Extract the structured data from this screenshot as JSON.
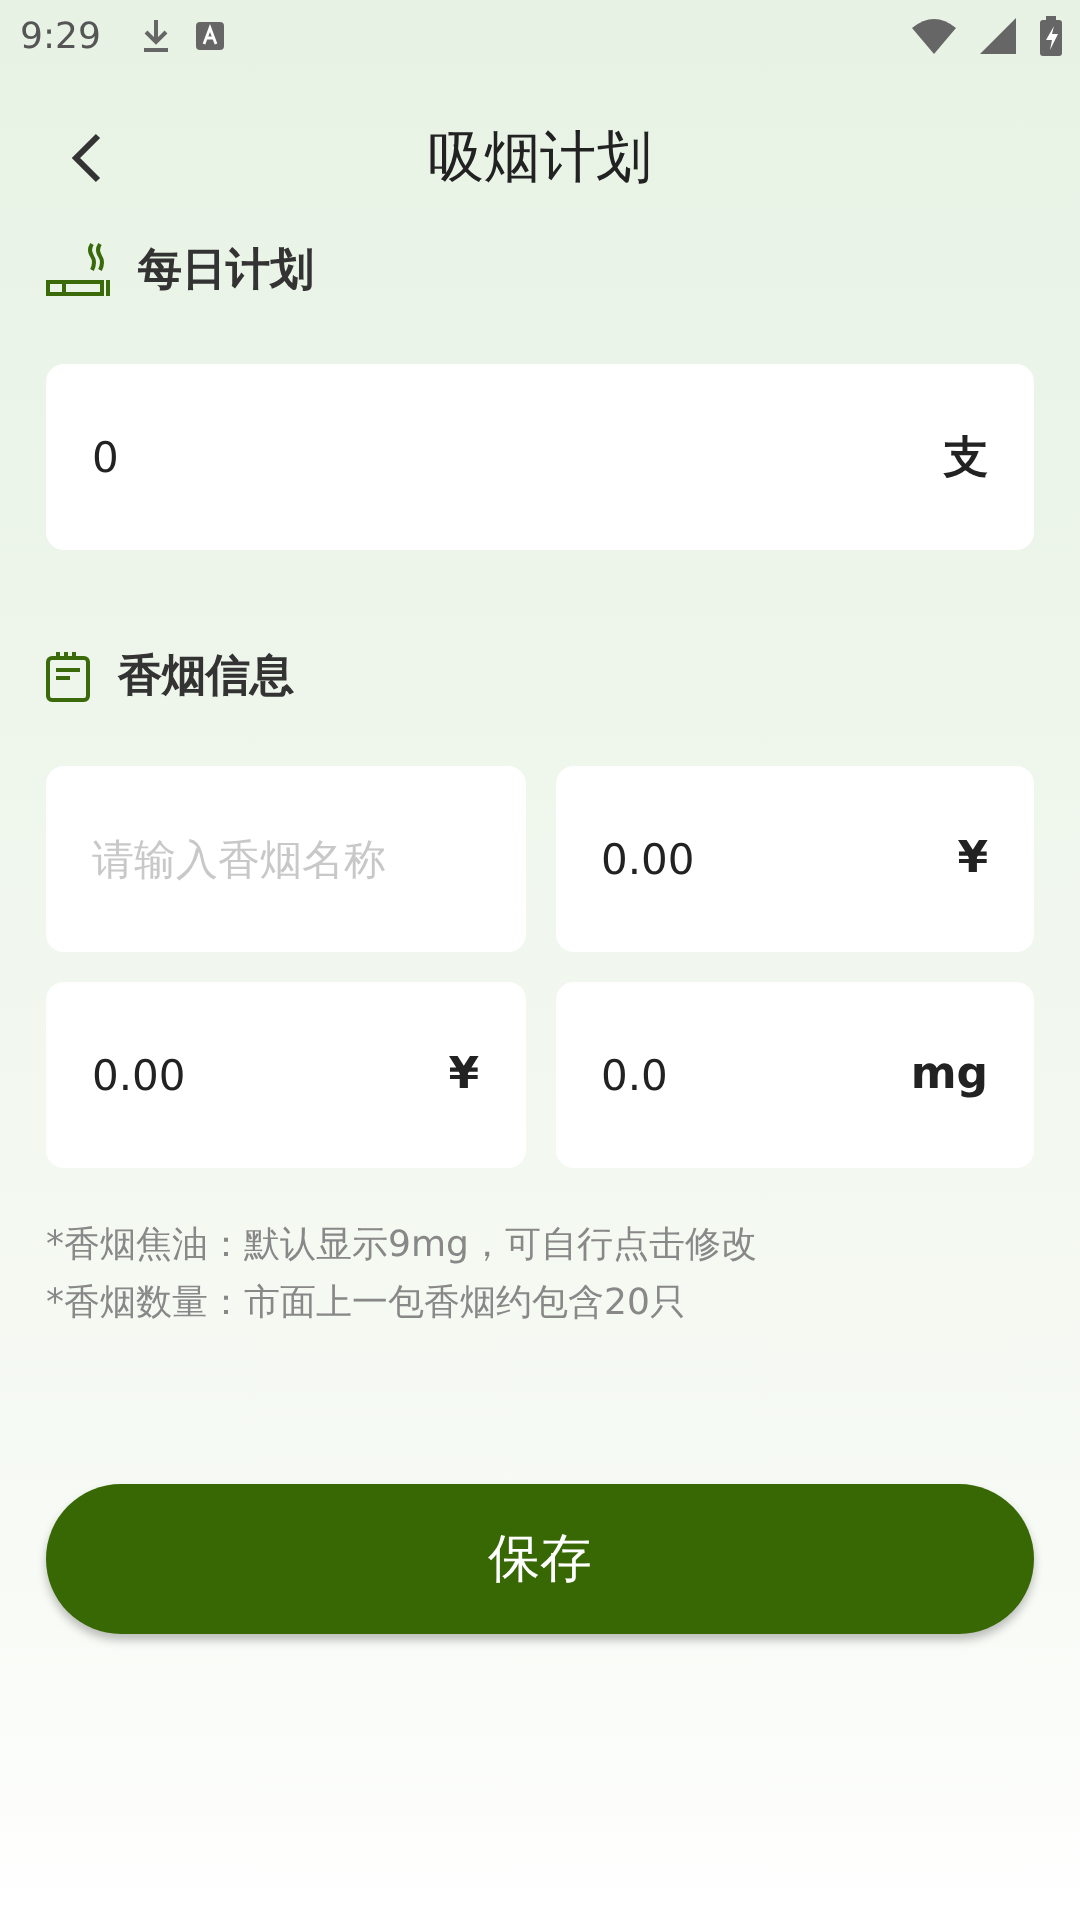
{
  "status_bar": {
    "time": "9:29"
  },
  "header": {
    "title": "吸烟计划"
  },
  "daily_plan": {
    "heading": "每日计划",
    "field": {
      "value": "0",
      "unit": "支"
    }
  },
  "cigarette_info": {
    "heading": "香烟信息",
    "fields": [
      {
        "placeholder": "请输入香烟名称"
      },
      {
        "value": "0.00",
        "unit": "¥"
      },
      {
        "value": "0.00",
        "unit": "¥"
      },
      {
        "value": "0.0",
        "unit": "mg"
      }
    ]
  },
  "notes": [
    "*香烟焦油：默认显示9mg，可自行点击修改",
    "*香烟数量：市面上一包香烟约包含20只"
  ],
  "save_button": "保存"
}
